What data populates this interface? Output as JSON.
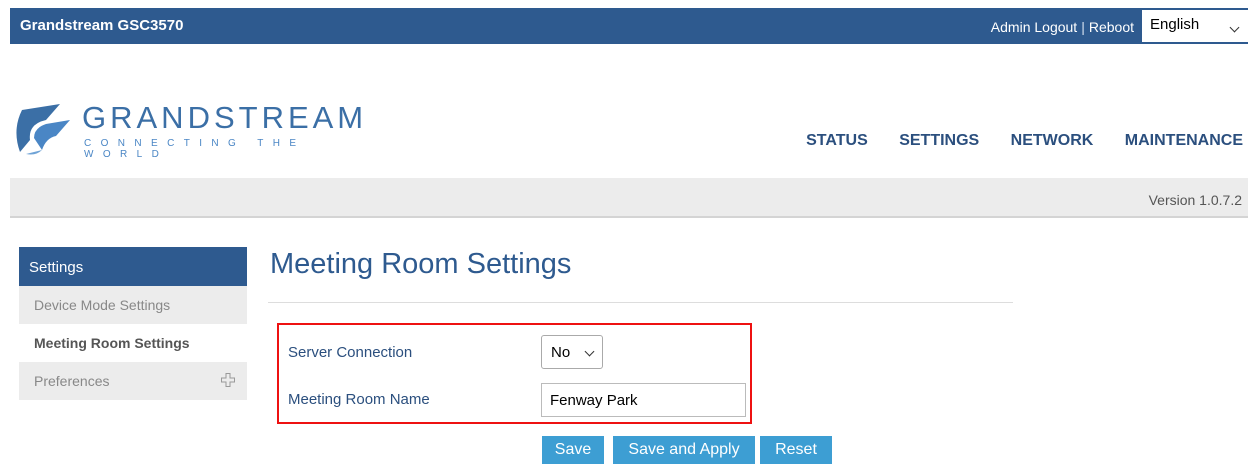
{
  "topbar": {
    "title": "Grandstream GSC3570",
    "admin_logout": "Admin Logout",
    "separator": "|",
    "reboot": "Reboot",
    "language": "English"
  },
  "logo": {
    "brand": "GRANDSTREAM",
    "tagline": "CONNECTING THE WORLD"
  },
  "nav": {
    "items": [
      "STATUS",
      "SETTINGS",
      "NETWORK",
      "MAINTENANCE"
    ]
  },
  "version": "Version 1.0.7.2",
  "sidebar": {
    "header": "Settings",
    "items": [
      {
        "label": "Device Mode Settings"
      },
      {
        "label": "Meeting Room Settings"
      },
      {
        "label": "Preferences"
      }
    ]
  },
  "main": {
    "title": "Meeting Room Settings",
    "fields": {
      "server_connection_label": "Server Connection",
      "server_connection_value": "No",
      "meeting_room_name_label": "Meeting Room Name",
      "meeting_room_name_value": "Fenway Park"
    },
    "buttons": {
      "save": "Save",
      "save_apply": "Save and Apply",
      "reset": "Reset"
    }
  },
  "colors": {
    "header_blue": "#2e5a8f",
    "button_blue": "#3d9ed3",
    "highlight_red": "#ee1111"
  }
}
